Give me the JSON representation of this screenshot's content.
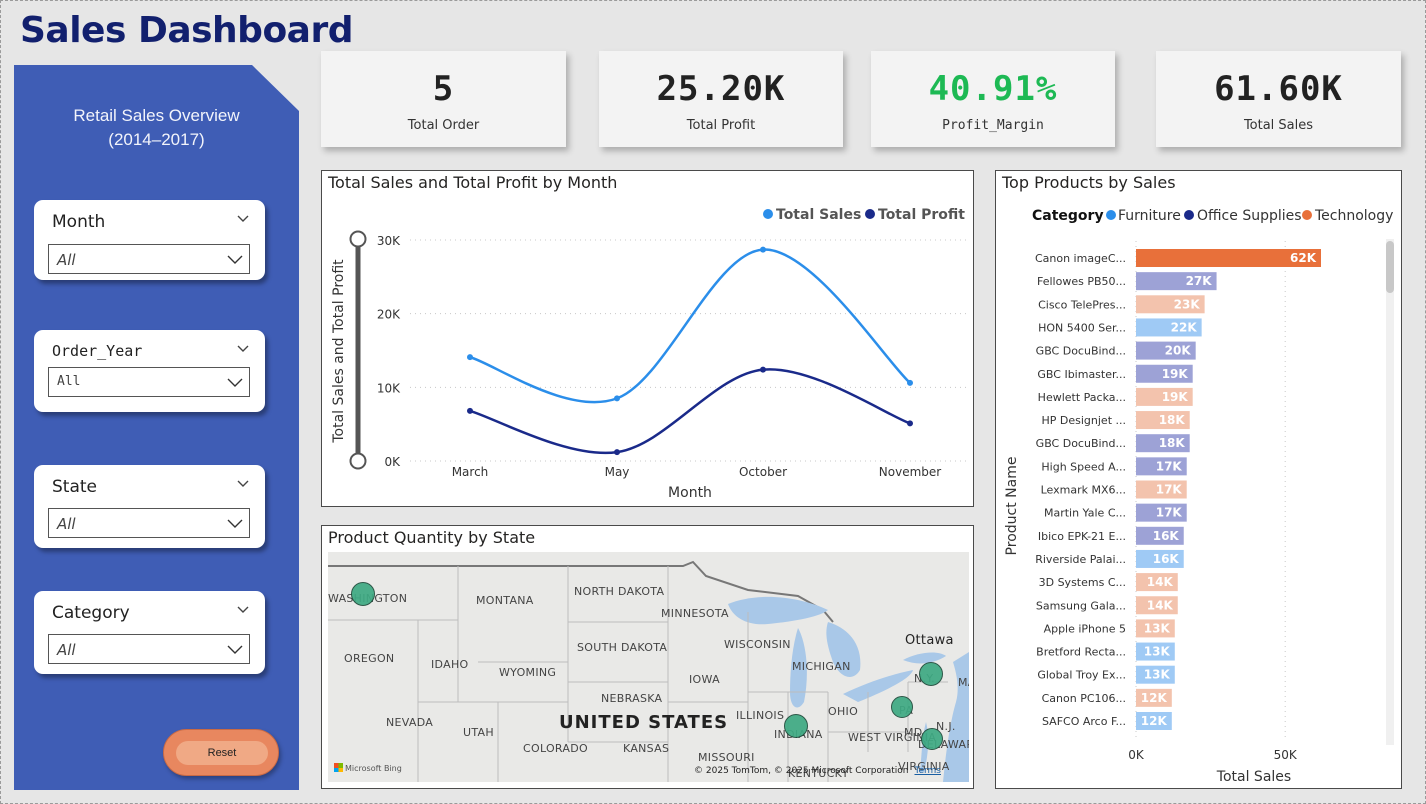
{
  "page": {
    "title": "Sales Dashboard"
  },
  "sidebar": {
    "heading_line1": "Retail Sales Overview",
    "heading_line2": "(2014–2017)",
    "background": "#3f5db5",
    "slicers": [
      {
        "label": "Month",
        "value": "All"
      },
      {
        "label": "Order_Year",
        "value": "All"
      },
      {
        "label": "State",
        "value": "All"
      },
      {
        "label": "Category",
        "value": "All"
      }
    ],
    "reset_label": "Reset"
  },
  "kpis": [
    {
      "value": "5",
      "label": "Total Order"
    },
    {
      "value": "25.20K",
      "label": "Total Profit"
    },
    {
      "value": "40.91%",
      "label": "Profit_Margin",
      "color": "#1db954"
    },
    {
      "value": "61.60K",
      "label": "Total Sales"
    }
  ],
  "line_chart": {
    "title": "Total Sales and Total Profit by Month",
    "legend": [
      {
        "name": "Total Sales",
        "color": "#2b8eea"
      },
      {
        "name": "Total Profit",
        "color": "#1a2a8a"
      }
    ],
    "xlabel": "Month",
    "ylabel": "Total Sales and Total Profit",
    "yticks": [
      "0K",
      "10K",
      "20K",
      "30K"
    ]
  },
  "map": {
    "title": "Product Quantity by State",
    "labels": {
      "washington": "WASHINGTON",
      "montana": "MONTANA",
      "north_dakota": "NORTH DAKOTA",
      "minnesota": "MINNESOTA",
      "south_dakota": "SOUTH DAKOTA",
      "wisconsin": "WISCONSIN",
      "oregon": "OREGON",
      "idaho": "IDAHO",
      "wyoming": "WYOMING",
      "michigan": "MICHIGAN",
      "iowa": "IOWA",
      "nebraska": "NEBRASKA",
      "ohio": "OHIO",
      "nevada": "NEVADA",
      "united_states": "UNITED STATES",
      "illinois": "ILLINOIS",
      "indiana": "INDIANA",
      "utah": "UTAH",
      "colorado": "COLORADO",
      "kansas": "KANSAS",
      "missouri": "MISSOURI",
      "west_virginia": "WEST VIRGINIA",
      "kentucky": "KENTUCKY",
      "virginia": "VIRGINIA",
      "ny": "N.Y.",
      "pa": "PA",
      "md": "MD",
      "nj": "N.J.",
      "delaware": "DELAWARE",
      "ottawa": "Ottawa",
      "ma": "MA"
    },
    "credit": "© 2025 TomTom, © 2025 Microsoft Corporation",
    "terms": "Terms",
    "bing": "Microsoft Bing",
    "bubble_color": "#3eaa83"
  },
  "chart_data": [
    {
      "type": "line",
      "title": "Total Sales and Total Profit by Month",
      "xlabel": "Month",
      "ylabel": "Total Sales and Total Profit",
      "categories": [
        "March",
        "May",
        "October",
        "November"
      ],
      "series": [
        {
          "name": "Total Sales",
          "values": [
            14100,
            8500,
            28700,
            10600
          ],
          "color": "#2b8eea"
        },
        {
          "name": "Total Profit",
          "values": [
            6800,
            1200,
            12400,
            5100
          ],
          "color": "#1a2a8a"
        }
      ],
      "ylim": [
        0,
        30000
      ],
      "grid": true,
      "legend": "top-right"
    },
    {
      "type": "bar",
      "orientation": "horizontal",
      "title": "Top Products by Sales",
      "xlabel": "Total Sales",
      "ylabel": "Product Name",
      "legend_title": "Category",
      "legend": [
        {
          "name": "Furniture",
          "color": "#2b8eea"
        },
        {
          "name": "Office Supplies",
          "color": "#1a2a8a"
        },
        {
          "name": "Technology",
          "color": "#e8703a"
        }
      ],
      "xticks": [
        "0K",
        "50K"
      ],
      "xlim": [
        0,
        62000
      ],
      "categories": [
        "Canon imageC...",
        "Fellowes PB50...",
        "Cisco TelePres...",
        "HON 5400 Ser...",
        "GBC DocuBind...",
        "GBC Ibimaster...",
        "Hewlett Packa...",
        "HP Designjet ...",
        "GBC DocuBind...",
        "High Speed A...",
        "Lexmark MX6...",
        "Martin Yale C...",
        "Ibico EPK-21 E...",
        "Riverside Palai...",
        "3D Systems C...",
        "Samsung Gala...",
        "Apple iPhone 5",
        "Bretford Recta...",
        "Global Troy Ex...",
        "Canon PC106...",
        "SAFCO Arco F..."
      ],
      "values": [
        62000,
        27000,
        23000,
        22000,
        20000,
        19000,
        19000,
        18000,
        18000,
        17000,
        17000,
        17000,
        16000,
        16000,
        14000,
        14000,
        13000,
        13000,
        13000,
        12000,
        12000
      ],
      "data_labels": [
        "62K",
        "27K",
        "23K",
        "22K",
        "20K",
        "19K",
        "19K",
        "18K",
        "18K",
        "17K",
        "17K",
        "17K",
        "16K",
        "16K",
        "14K",
        "14K",
        "13K",
        "13K",
        "13K",
        "12K",
        "12K"
      ],
      "bar_colors": [
        "#e8703a",
        "#9da2d6",
        "#f3c3ad",
        "#9fcaf5",
        "#9da2d6",
        "#9da2d6",
        "#f3c3ad",
        "#f3c3ad",
        "#9da2d6",
        "#9da2d6",
        "#f3c3ad",
        "#9da2d6",
        "#9da2d6",
        "#9fcaf5",
        "#f3c3ad",
        "#f3c3ad",
        "#f3c3ad",
        "#9fcaf5",
        "#9fcaf5",
        "#f3c3ad",
        "#9fcaf5"
      ],
      "grid": true
    }
  ]
}
